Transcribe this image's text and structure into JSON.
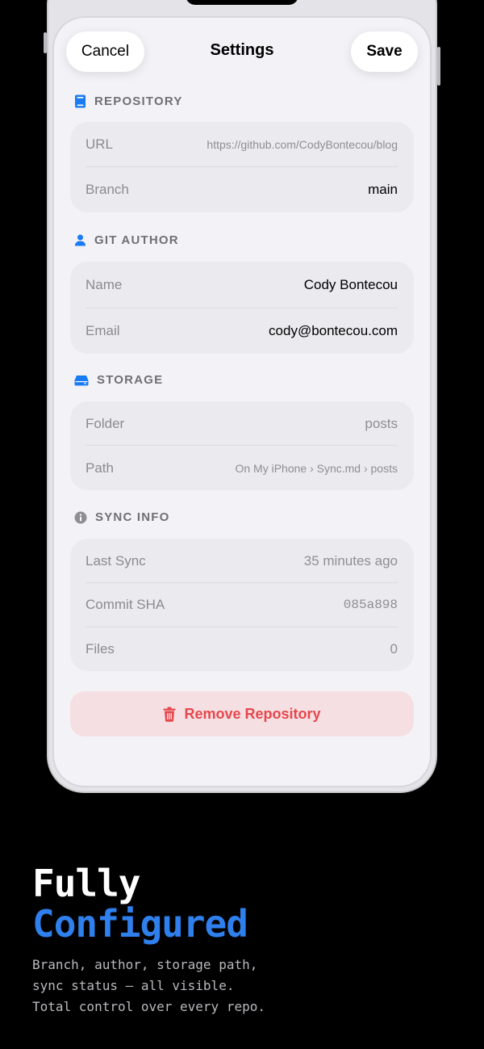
{
  "nav": {
    "cancel_label": "Cancel",
    "title": "Settings",
    "save_label": "Save"
  },
  "sections": {
    "repository": {
      "header": "REPOSITORY",
      "icon": "book-icon",
      "rows": [
        {
          "label": "URL",
          "value": "https://github.com/CodyBontecou/blog"
        },
        {
          "label": "Branch",
          "value": "main"
        }
      ]
    },
    "git_author": {
      "header": "GIT AUTHOR",
      "icon": "person-icon",
      "rows": [
        {
          "label": "Name",
          "value": "Cody Bontecou"
        },
        {
          "label": "Email",
          "value": "cody@bontecou.com"
        }
      ]
    },
    "storage": {
      "header": "STORAGE",
      "icon": "drive-icon",
      "rows": [
        {
          "label": "Folder",
          "value": "posts"
        },
        {
          "label": "Path",
          "value": "On My iPhone › Sync.md › posts"
        }
      ]
    },
    "sync_info": {
      "header": "SYNC INFO",
      "icon": "info-icon",
      "rows": [
        {
          "label": "Last Sync",
          "value": "35 minutes ago"
        },
        {
          "label": "Commit SHA",
          "value": "085a898"
        },
        {
          "label": "Files",
          "value": "0"
        }
      ]
    }
  },
  "remove_button": {
    "label": "Remove Repository",
    "icon": "trash-icon"
  },
  "marketing": {
    "headline_line1": "Fully",
    "headline_line2": "Configured",
    "subtitle_lines": [
      "Branch, author, storage path,",
      "sync status — all visible.",
      "Total control over every repo."
    ]
  },
  "colors": {
    "accent_blue": "#2f80ed",
    "icon_blue": "#1a7cf5",
    "destructive_red": "#e5484d",
    "background": "#000000",
    "sheet": "#f2f2f7"
  }
}
